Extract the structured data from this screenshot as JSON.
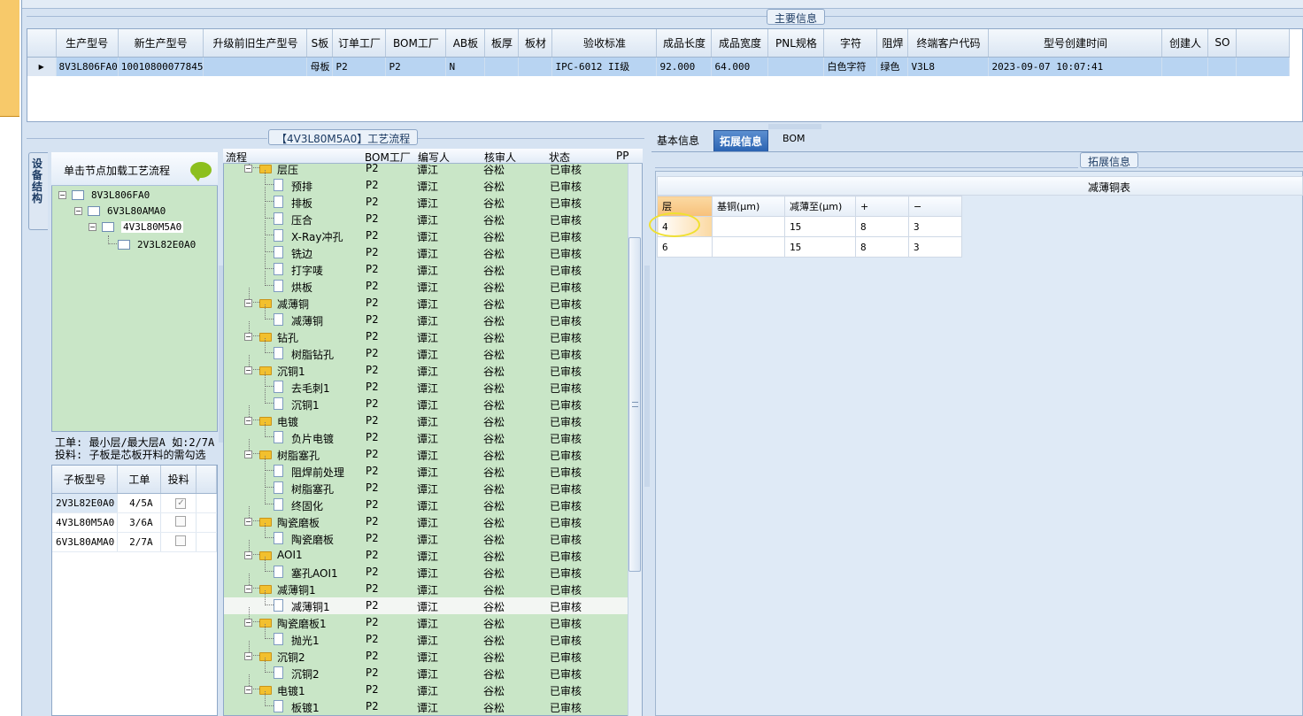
{
  "main_info": {
    "title": "主要信息",
    "columns": [
      "生产型号",
      "新生产型号",
      "升级前旧生产型号",
      "S板",
      "订单工厂",
      "BOM工厂",
      "AB板",
      "板厚",
      "板材",
      "验收标准",
      "成品长度",
      "成品宽度",
      "PNL规格",
      "字符",
      "阻焊",
      "终端客户代码",
      "型号创建时间",
      "创建人",
      "SO"
    ],
    "row_marker": "▶",
    "row": [
      "8V3L806FA0",
      "10010800077845",
      "",
      "母板",
      "P2",
      "P2",
      "N",
      "",
      "",
      "IPC-6012 II级",
      "92.000",
      "64.000",
      "",
      "白色字符",
      "绿色",
      "V3L8",
      "2023-09-07 10:07:41",
      "",
      ""
    ]
  },
  "left_panel": {
    "vertical_tab": "设备结构",
    "tree_header": "单击节点加载工艺流程",
    "tree": [
      {
        "label": "8V3L806FA0",
        "toggle": "−"
      },
      {
        "label": "6V3L80AMA0",
        "toggle": "−"
      },
      {
        "label": "4V3L80M5A0",
        "toggle": "−"
      },
      {
        "label": "2V3L82E0A0",
        "toggle": ""
      }
    ],
    "note_line1": "工单: 最小层/最大层A 如:2/7A",
    "note_line2": "投料: 子板是芯板开料的需勾选",
    "sub_columns": [
      "子板型号",
      "工单",
      "投料"
    ],
    "sub_rows": [
      {
        "model": "2V3L82E0A0",
        "order": "4/5A",
        "checked": "✓"
      },
      {
        "model": "4V3L80M5A0",
        "order": "3/6A",
        "checked": ""
      },
      {
        "model": "6V3L80AMA0",
        "order": "2/7A",
        "checked": ""
      }
    ]
  },
  "flow": {
    "title": "【4V3L80M5A0】工艺流程",
    "columns": [
      "流程",
      "BOM工厂",
      "编写人",
      "核审人",
      "状态",
      "PP"
    ],
    "rows": [
      {
        "name": "层压",
        "type": "folder",
        "f": "P2",
        "w": "谭江",
        "r": "谷松",
        "s": "已审核"
      },
      {
        "name": "预排",
        "type": "doc",
        "f": "P2",
        "w": "谭江",
        "r": "谷松",
        "s": "已审核"
      },
      {
        "name": "排板",
        "type": "doc",
        "f": "P2",
        "w": "谭江",
        "r": "谷松",
        "s": "已审核"
      },
      {
        "name": "压合",
        "type": "doc",
        "f": "P2",
        "w": "谭江",
        "r": "谷松",
        "s": "已审核"
      },
      {
        "name": "X-Ray冲孔",
        "type": "doc",
        "f": "P2",
        "w": "谭江",
        "r": "谷松",
        "s": "已审核"
      },
      {
        "name": "铣边",
        "type": "doc",
        "f": "P2",
        "w": "谭江",
        "r": "谷松",
        "s": "已审核"
      },
      {
        "name": "打字唛",
        "type": "doc",
        "f": "P2",
        "w": "谭江",
        "r": "谷松",
        "s": "已审核"
      },
      {
        "name": "烘板",
        "type": "doc",
        "f": "P2",
        "w": "谭江",
        "r": "谷松",
        "s": "已审核"
      },
      {
        "name": "减薄铜",
        "type": "folder",
        "f": "P2",
        "w": "谭江",
        "r": "谷松",
        "s": "已审核"
      },
      {
        "name": "减薄铜",
        "type": "doc",
        "f": "P2",
        "w": "谭江",
        "r": "谷松",
        "s": "已审核"
      },
      {
        "name": "钻孔",
        "type": "folder",
        "f": "P2",
        "w": "谭江",
        "r": "谷松",
        "s": "已审核"
      },
      {
        "name": "树脂钻孔",
        "type": "doc",
        "f": "P2",
        "w": "谭江",
        "r": "谷松",
        "s": "已审核"
      },
      {
        "name": "沉铜1",
        "type": "folder",
        "f": "P2",
        "w": "谭江",
        "r": "谷松",
        "s": "已审核"
      },
      {
        "name": "去毛刺1",
        "type": "doc",
        "f": "P2",
        "w": "谭江",
        "r": "谷松",
        "s": "已审核"
      },
      {
        "name": "沉铜1",
        "type": "doc",
        "f": "P2",
        "w": "谭江",
        "r": "谷松",
        "s": "已审核"
      },
      {
        "name": "电镀",
        "type": "folder",
        "f": "P2",
        "w": "谭江",
        "r": "谷松",
        "s": "已审核"
      },
      {
        "name": "负片电镀",
        "type": "doc",
        "f": "P2",
        "w": "谭江",
        "r": "谷松",
        "s": "已审核"
      },
      {
        "name": "树脂塞孔",
        "type": "folder",
        "f": "P2",
        "w": "谭江",
        "r": "谷松",
        "s": "已审核"
      },
      {
        "name": "阻焊前处理",
        "type": "doc",
        "f": "P2",
        "w": "谭江",
        "r": "谷松",
        "s": "已审核"
      },
      {
        "name": "树脂塞孔",
        "type": "doc",
        "f": "P2",
        "w": "谭江",
        "r": "谷松",
        "s": "已审核"
      },
      {
        "name": "终固化",
        "type": "doc",
        "f": "P2",
        "w": "谭江",
        "r": "谷松",
        "s": "已审核"
      },
      {
        "name": "陶瓷磨板",
        "type": "folder",
        "f": "P2",
        "w": "谭江",
        "r": "谷松",
        "s": "已审核"
      },
      {
        "name": "陶瓷磨板",
        "type": "doc",
        "f": "P2",
        "w": "谭江",
        "r": "谷松",
        "s": "已审核"
      },
      {
        "name": "AOI1",
        "type": "folder",
        "f": "P2",
        "w": "谭江",
        "r": "谷松",
        "s": "已审核"
      },
      {
        "name": "塞孔AOI1",
        "type": "doc",
        "f": "P2",
        "w": "谭江",
        "r": "谷松",
        "s": "已审核"
      },
      {
        "name": "减薄铜1",
        "type": "folder",
        "f": "P2",
        "w": "谭江",
        "r": "谷松",
        "s": "已审核"
      },
      {
        "name": "减薄铜1",
        "type": "doc",
        "f": "P2",
        "w": "谭江",
        "r": "谷松",
        "s": "已审核",
        "selected": true
      },
      {
        "name": "陶瓷磨板1",
        "type": "folder",
        "f": "P2",
        "w": "谭江",
        "r": "谷松",
        "s": "已审核"
      },
      {
        "name": "抛光1",
        "type": "doc",
        "f": "P2",
        "w": "谭江",
        "r": "谷松",
        "s": "已审核"
      },
      {
        "name": "沉铜2",
        "type": "folder",
        "f": "P2",
        "w": "谭江",
        "r": "谷松",
        "s": "已审核"
      },
      {
        "name": "沉铜2",
        "type": "doc",
        "f": "P2",
        "w": "谭江",
        "r": "谷松",
        "s": "已审核"
      },
      {
        "name": "电镀1",
        "type": "folder",
        "f": "P2",
        "w": "谭江",
        "r": "谷松",
        "s": "已审核"
      },
      {
        "name": "板镀1",
        "type": "doc",
        "f": "P2",
        "w": "谭江",
        "r": "谷松",
        "s": "已审核"
      }
    ]
  },
  "right_panel": {
    "tabs": [
      "基本信息",
      "拓展信息",
      "BOM"
    ],
    "active_tab": "拓展信息",
    "group_title": "拓展信息",
    "table_title": "减薄铜表",
    "columns": [
      "层",
      "基铜(μm)",
      "减薄至(μm)",
      "+",
      "−"
    ],
    "rows": [
      [
        "4",
        "",
        "15",
        "8",
        "3"
      ],
      [
        "6",
        "",
        "15",
        "8",
        "3"
      ]
    ]
  },
  "colors": {
    "tree_bg": "#c9e6c7",
    "selected_row": "#b8d4f2",
    "active_tab": "#2b63b2",
    "highlight_circle": "#f0e030"
  }
}
